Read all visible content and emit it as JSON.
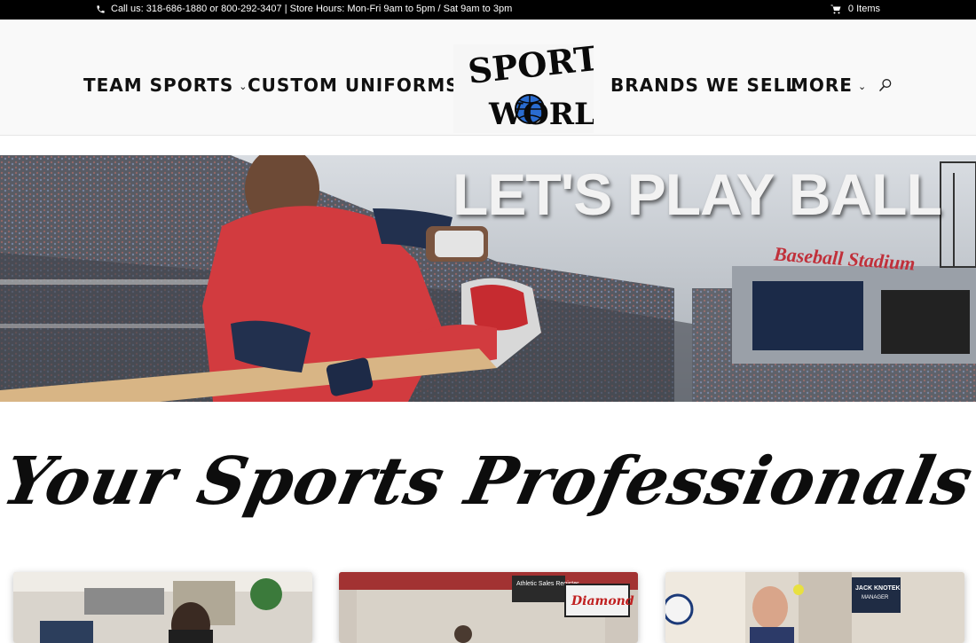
{
  "topbar": {
    "contact_text": "Call us: 318-686-1880 or 800-292-3407 | Store Hours: Mon-Fri 9am to 5pm / Sat 9am to 3pm",
    "cart_text": "0 Items",
    "icons": [
      "phone-icon",
      "cart-icon"
    ]
  },
  "nav": {
    "team_sports": "TEAM SPORTS",
    "custom_uniforms": "CUSTOM UNIFORMS",
    "brands": "BRANDS WE SELL",
    "more": "MORE",
    "icons": [
      "chevron-down-icon",
      "search-icon"
    ]
  },
  "logo": {
    "line1": "SPORTS",
    "line2": "WORLD"
  },
  "hero": {
    "headline": "LET'S PLAY BALL",
    "stadium_sign": "Baseball Stadium"
  },
  "tagline": "Your Sports Professionals",
  "cards": {
    "card2_sign": "Athletic Sales Register",
    "card2_brand": "Diamond",
    "card3_sign_name": "JACK KNOTEK",
    "card3_sign_role": "MANAGER"
  }
}
